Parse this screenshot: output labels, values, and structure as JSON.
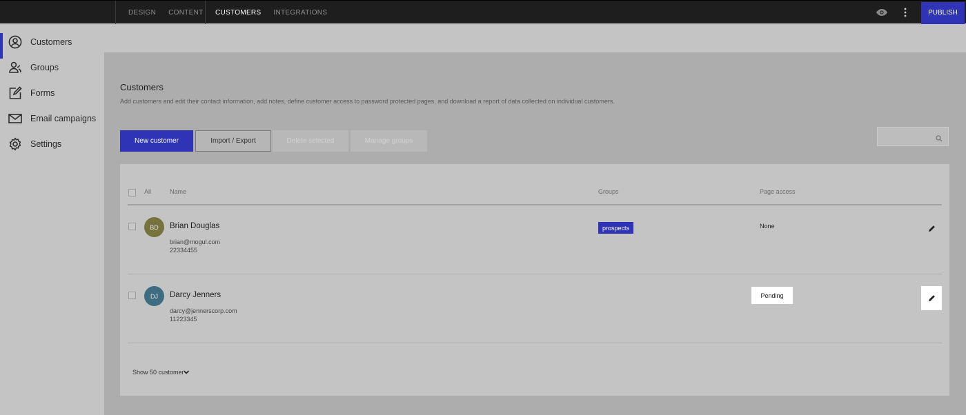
{
  "topbar": {
    "nav_group_1": [
      "DESIGN",
      "CONTENT"
    ],
    "nav_group_2": [
      "CUSTOMERS",
      "INTEGRATIONS"
    ],
    "active": "CUSTOMERS",
    "publish_label": "PUBLISH",
    "preview_icon": "eye-icon",
    "more_icon": "vertical-dots-icon"
  },
  "sidebar": {
    "items": [
      {
        "label": "Customers",
        "icon": "user-circle-icon",
        "active": true
      },
      {
        "label": "Groups",
        "icon": "users-group-icon",
        "active": false
      },
      {
        "label": "Forms",
        "icon": "form-edit-icon",
        "active": false
      },
      {
        "label": "Email campaigns",
        "icon": "envelope-icon",
        "active": false
      },
      {
        "label": "Settings",
        "icon": "gear-icon",
        "active": false
      }
    ]
  },
  "main": {
    "title": "Customers",
    "description": "Add customers and edit their contact information, add notes, define customer access to password protected pages, and download a report of data collected on individual customers.",
    "buttons": {
      "new": "New customer",
      "import": "Import / Export",
      "delete": "Delete selected",
      "groups": "Manage groups"
    },
    "search_placeholder": ""
  },
  "table": {
    "headers": {
      "all": "All",
      "name": "Name",
      "groups": "Groups",
      "access": "Page access"
    },
    "rows": [
      {
        "initials": "BD",
        "name": "Brian Douglas",
        "email": "brian@mogul.com",
        "phone": "22334455",
        "group": "prospects",
        "access": "None",
        "avatar_color": "#77733f"
      },
      {
        "initials": "DJ",
        "name": "Darcy Jenners",
        "email": "darcy@jennerscorp.com",
        "phone": "11223345",
        "group": "",
        "access": "Pending",
        "avatar_color": "#3e6d82"
      }
    ],
    "pager_label": "Show 50 customers"
  },
  "colors": {
    "accent": "#2e34b5",
    "topbar": "#1e1e1e"
  }
}
